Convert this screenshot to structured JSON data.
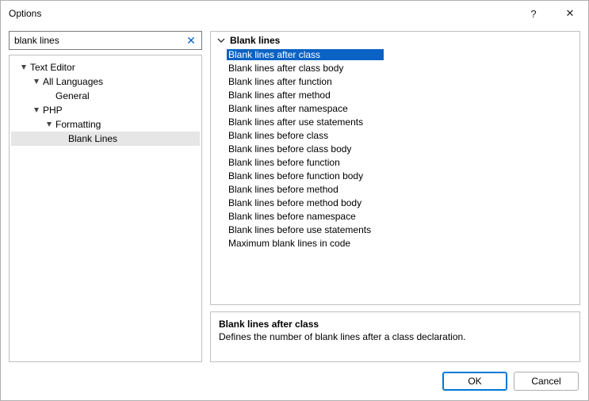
{
  "window": {
    "title": "Options",
    "help_glyph": "?",
    "close_glyph": "✕"
  },
  "search": {
    "value": "blank lines",
    "clear_glyph": "✕"
  },
  "tree": [
    {
      "level": 0,
      "expandable": true,
      "label": "Text Editor",
      "selected": false
    },
    {
      "level": 1,
      "expandable": true,
      "label": "All Languages",
      "selected": false
    },
    {
      "level": 2,
      "expandable": false,
      "label": "General",
      "selected": false
    },
    {
      "level": 1,
      "expandable": true,
      "label": "PHP",
      "selected": false
    },
    {
      "level": 2,
      "expandable": true,
      "label": "Formatting",
      "selected": false
    },
    {
      "level": 3,
      "expandable": false,
      "label": "Blank Lines",
      "selected": true
    }
  ],
  "settings": {
    "group_label": "Blank lines",
    "items": [
      {
        "label": "Blank lines after class",
        "selected": true
      },
      {
        "label": "Blank lines after class body",
        "selected": false
      },
      {
        "label": "Blank lines after function",
        "selected": false
      },
      {
        "label": "Blank lines after method",
        "selected": false
      },
      {
        "label": "Blank lines after namespace",
        "selected": false
      },
      {
        "label": "Blank lines after use statements",
        "selected": false
      },
      {
        "label": "Blank lines before class",
        "selected": false
      },
      {
        "label": "Blank lines before class body",
        "selected": false
      },
      {
        "label": "Blank lines before function",
        "selected": false
      },
      {
        "label": "Blank lines before function body",
        "selected": false
      },
      {
        "label": "Blank lines before method",
        "selected": false
      },
      {
        "label": "Blank lines before method body",
        "selected": false
      },
      {
        "label": "Blank lines before namespace",
        "selected": false
      },
      {
        "label": "Blank lines before use statements",
        "selected": false
      },
      {
        "label": "Maximum blank lines in code",
        "selected": false
      }
    ]
  },
  "description": {
    "title": "Blank lines after class",
    "text": "Defines the number of blank lines after a class declaration."
  },
  "buttons": {
    "ok": "OK",
    "cancel": "Cancel"
  }
}
